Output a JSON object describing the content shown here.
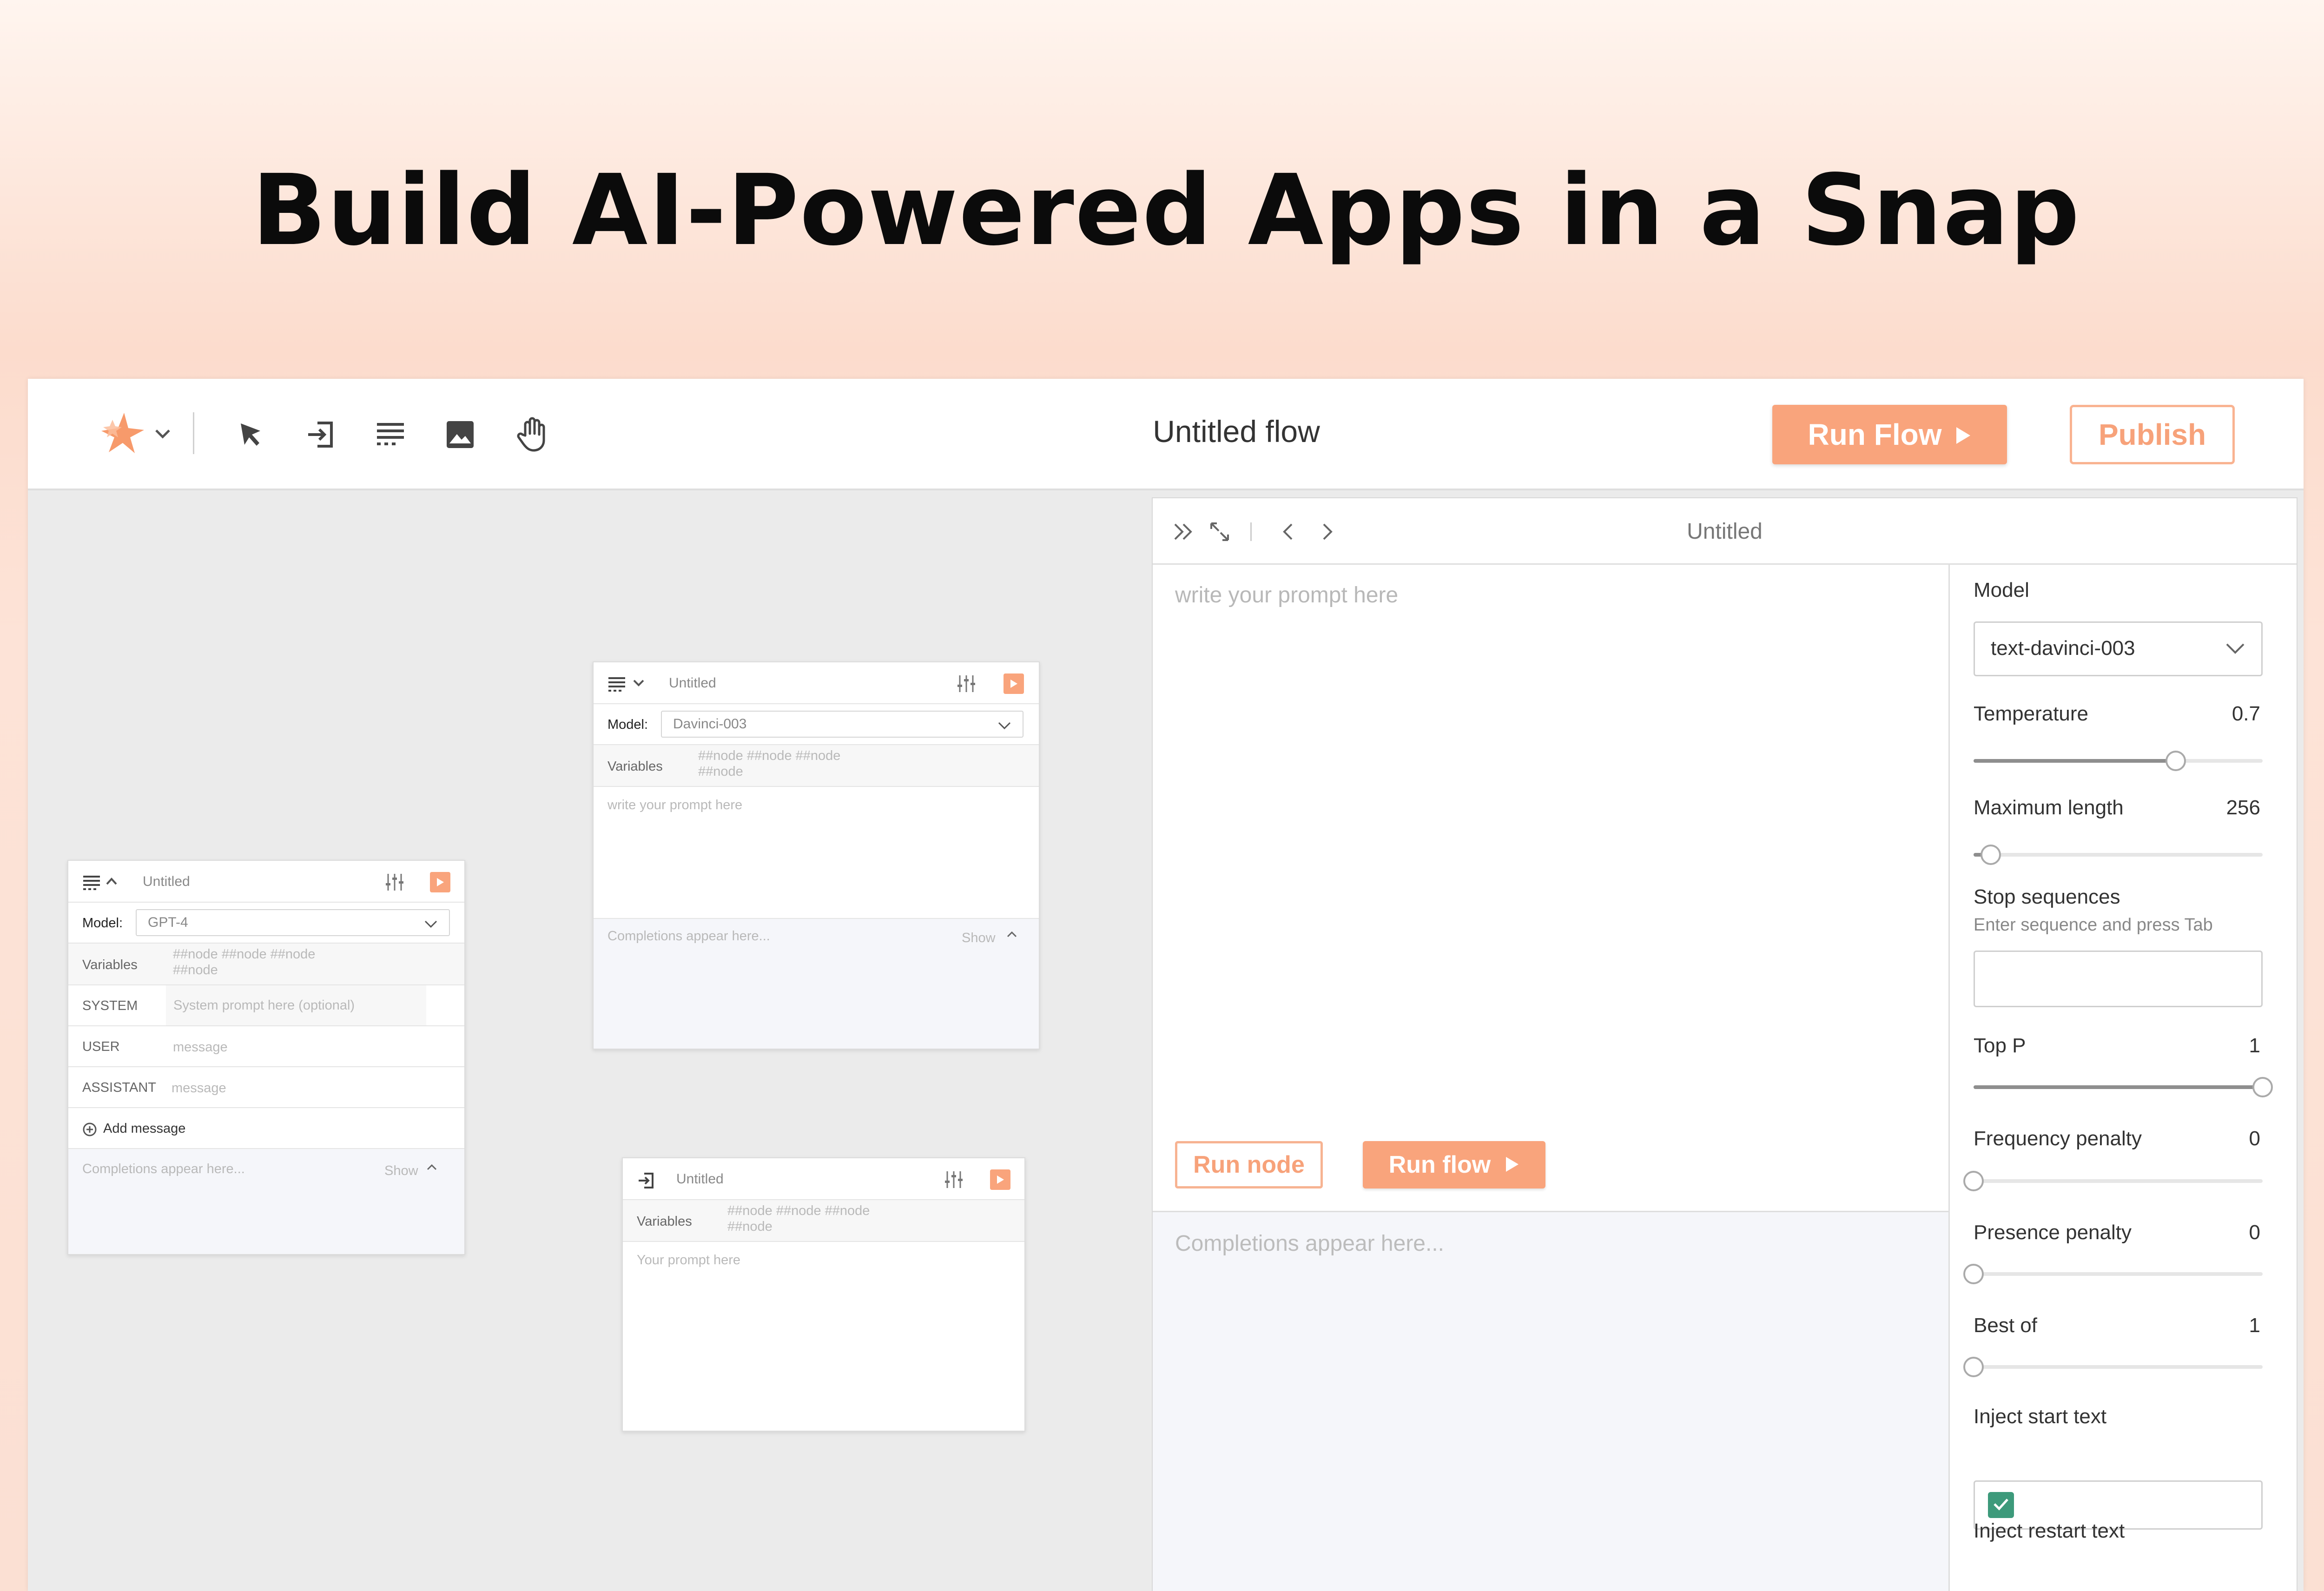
{
  "hero": {
    "title": "Build AI-Powered Apps in a Snap"
  },
  "toolbar": {
    "logo_icon": "sparkle-logo-icon",
    "tools": [
      "cursor-icon",
      "input-node-icon",
      "prompt-node-icon",
      "image-icon",
      "hand-icon"
    ],
    "flow_title": "Untitled flow",
    "run_flow_label": "Run Flow",
    "publish_label": "Publish",
    "accent": "#f9a47c"
  },
  "canvas": {
    "node_chat": {
      "title": "Untitled",
      "model_label": "Model:",
      "model_value": "GPT-4",
      "variables_label": "Variables",
      "variables_placeholder_1": "##node ##node ##node",
      "variables_placeholder_2": "##node",
      "system_label": "SYSTEM",
      "system_placeholder": "System prompt here (optional)",
      "user_label": "USER",
      "user_placeholder": "message",
      "assistant_label": "ASSISTANT",
      "assistant_placeholder": "message",
      "add_message_label": "Add message",
      "completions_placeholder": "Completions appear here...",
      "show_label": "Show"
    },
    "node_completion": {
      "title": "Untitled",
      "model_label": "Model:",
      "model_value": "Davinci-003",
      "variables_label": "Variables",
      "variables_placeholder_1": "##node ##node ##node",
      "variables_placeholder_2": "##node",
      "prompt_placeholder": "write your prompt here",
      "completions_placeholder": "Completions appear here...",
      "show_label": "Show"
    },
    "node_input": {
      "title": "Untitled",
      "variables_label": "Variables",
      "variables_placeholder_1": "##node ##node ##node",
      "variables_placeholder_2": "##node",
      "prompt_placeholder": "Your prompt here"
    }
  },
  "panel": {
    "title": "Untitled",
    "prompt_placeholder": "write your prompt here",
    "run_node_label": "Run node",
    "run_flow_label": "Run flow",
    "completions_placeholder": "Completions appear here...",
    "settings": {
      "model_label": "Model",
      "model_value": "text-davinci-003",
      "temperature_label": "Temperature",
      "temperature_value": "0.7",
      "temperature_fraction": 0.7,
      "max_length_label": "Maximum length",
      "max_length_value": "256",
      "max_length_fraction": 0.06,
      "stop_label": "Stop sequences",
      "stop_hint": "Enter sequence and press Tab",
      "top_p_label": "Top P",
      "top_p_value": "1",
      "top_p_fraction": 1.0,
      "freq_label": "Frequency penalty",
      "freq_value": "0",
      "freq_fraction": 0,
      "presence_label": "Presence penalty",
      "presence_value": "0",
      "presence_fraction": 0,
      "best_of_label": "Best of",
      "best_of_value": "1",
      "best_of_fraction": 0,
      "inject_start_label": "Inject start text",
      "inject_start_checked": true,
      "inject_restart_label": "Inject restart text",
      "inject_restart_checked": true,
      "check_color": "#3d9a7b"
    }
  }
}
